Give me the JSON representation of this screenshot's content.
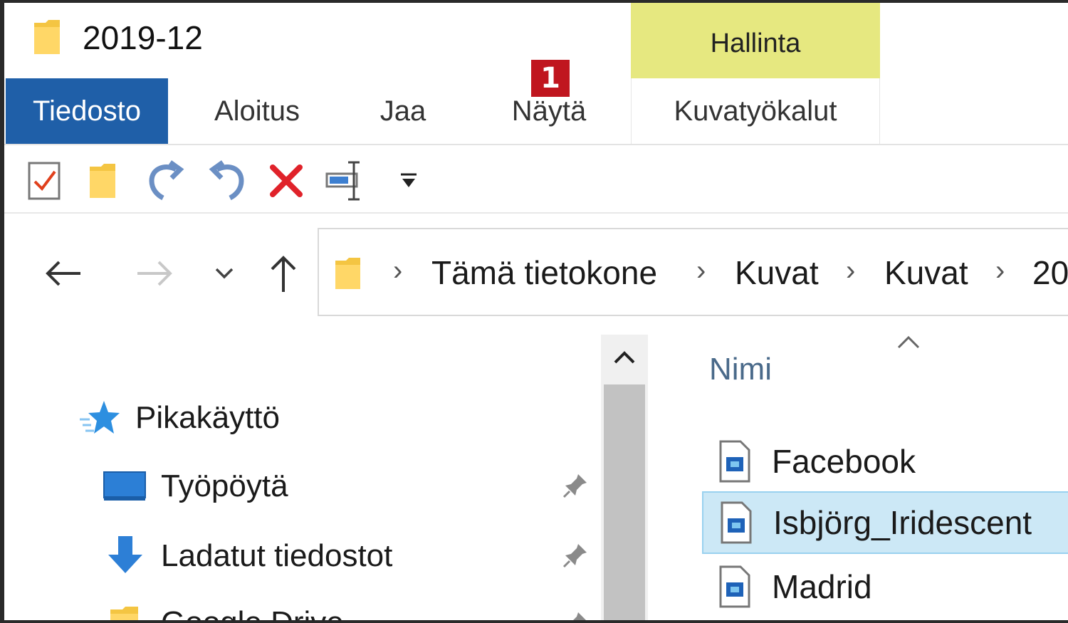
{
  "window": {
    "title": "2019-12"
  },
  "ribbon": {
    "context_group": "Hallinta",
    "tabs": [
      {
        "label": "Tiedosto",
        "active": true
      },
      {
        "label": "Aloitus"
      },
      {
        "label": "Jaa"
      },
      {
        "label": "Näytä"
      },
      {
        "label": "Kuvatyökalut"
      }
    ],
    "badge": "1"
  },
  "quick_access": {
    "items": [
      "properties-icon",
      "new-folder-icon",
      "redo-icon",
      "undo-icon",
      "delete-icon",
      "rename-icon",
      "customize-dropdown-icon"
    ]
  },
  "address": {
    "crumbs": [
      "Tämä tietokone",
      "Kuvat",
      "Kuvat",
      "20"
    ]
  },
  "nav": {
    "items": [
      {
        "label": "Pikakäyttö",
        "icon": "star-icon"
      },
      {
        "label": "Työpöytä",
        "icon": "desktop-icon",
        "pinned": true
      },
      {
        "label": "Ladatut tiedostot",
        "icon": "download-icon",
        "pinned": true
      },
      {
        "label": "Google Drive",
        "icon": "folder-icon",
        "pinned": true
      }
    ]
  },
  "files": {
    "column": "Nimi",
    "items": [
      {
        "name": "Facebook",
        "selected": false
      },
      {
        "name": "Isbjörg_Iridescent",
        "selected": true
      },
      {
        "name": "Madrid",
        "selected": false
      }
    ]
  },
  "colors": {
    "file_tab": "#1f5fa8",
    "context_group": "#e6e880",
    "badge": "#c0161f",
    "selection": "#cce8f6"
  }
}
